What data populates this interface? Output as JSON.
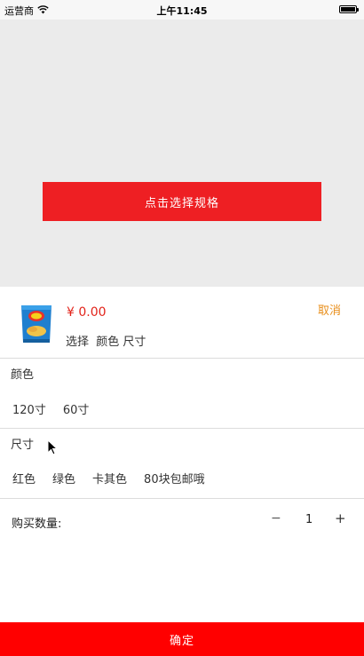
{
  "status_bar": {
    "carrier": "运营商",
    "time": "上午11:45",
    "wifi_icon": "wifi-icon",
    "battery_level": 1.0
  },
  "select_button": {
    "label": "点击选择规格"
  },
  "sheet": {
    "product": {
      "thumbnail_icon": "chips-bag-icon",
      "price": "¥ 0.00",
      "spec_hint": "选择  颜色 尺寸",
      "cancel_label": "取消"
    },
    "groups": [
      {
        "title": "颜色",
        "options": [
          "120寸",
          "60寸"
        ]
      },
      {
        "title": "尺寸",
        "options": [
          "红色",
          "绿色",
          "卡其色",
          "80块包邮哦"
        ]
      }
    ],
    "quantity": {
      "label": "购买数量:",
      "minus": "−",
      "value": "1",
      "plus": "+"
    },
    "confirm_label": "确定"
  },
  "colors": {
    "accent_red": "#ee1f23",
    "confirm_red": "#ff0000",
    "price_red": "#e2231a",
    "cancel_orange": "#e88e1a",
    "background": "#ebebeb"
  }
}
